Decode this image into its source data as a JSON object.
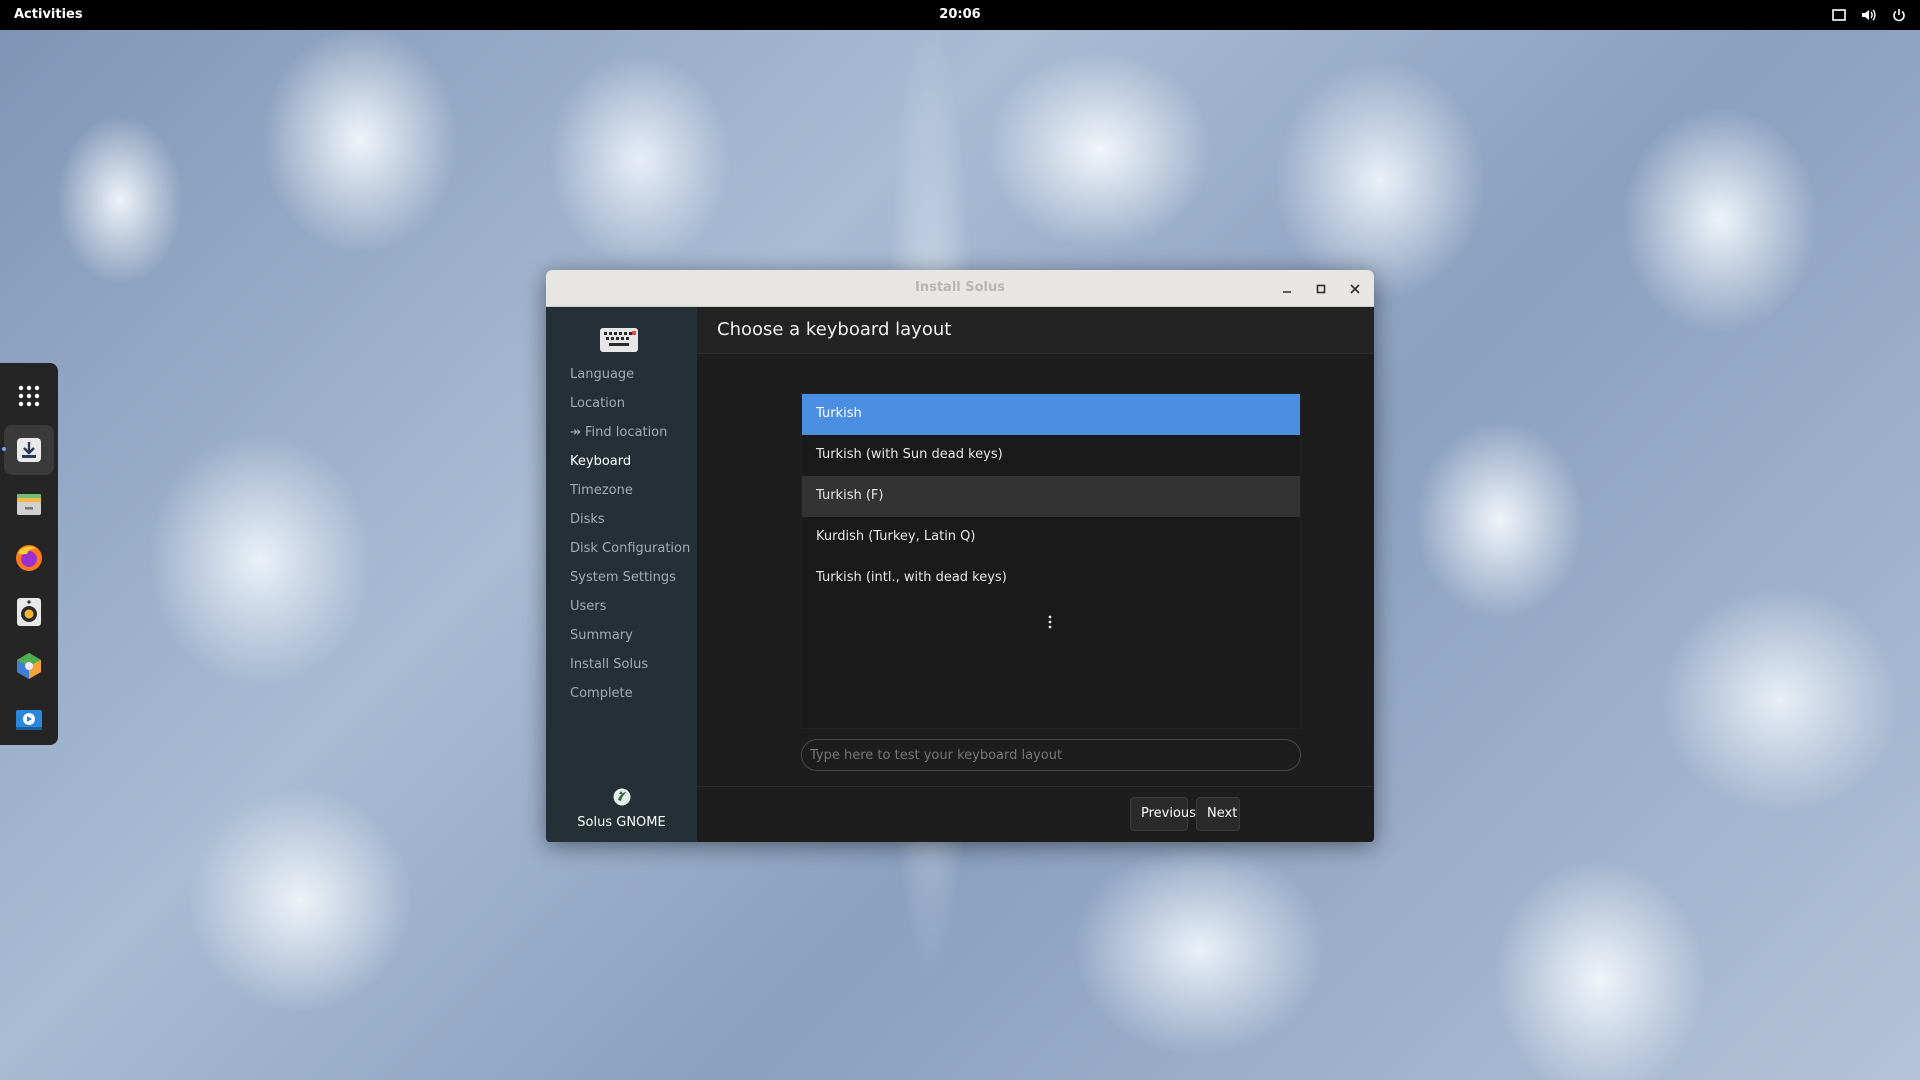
{
  "topbar": {
    "activities": "Activities",
    "clock": "20:06",
    "tray_icons": [
      "screen-icon",
      "volume-icon",
      "power-icon"
    ]
  },
  "dock": {
    "items": [
      "app-grid-icon",
      "installer-icon",
      "files-icon",
      "firefox-icon",
      "rhythmbox-icon",
      "software-icon",
      "video-icon"
    ]
  },
  "window": {
    "title": "Install Solus",
    "sidebar": {
      "items": [
        {
          "label": "Language",
          "active": false
        },
        {
          "label": "Location",
          "active": false
        },
        {
          "label": "↠ Find location",
          "active": false
        },
        {
          "label": "Keyboard",
          "active": true
        },
        {
          "label": "Timezone",
          "active": false
        },
        {
          "label": "Disks",
          "active": false
        },
        {
          "label": "Disk Configuration",
          "active": false
        },
        {
          "label": "System Settings",
          "active": false
        },
        {
          "label": "Users",
          "active": false
        },
        {
          "label": "Summary",
          "active": false
        },
        {
          "label": "Install Solus",
          "active": false
        },
        {
          "label": "Complete",
          "active": false
        }
      ],
      "brand": "Solus GNOME"
    },
    "header": {
      "title": "Choose a keyboard layout"
    },
    "layouts": [
      {
        "label": "Turkish",
        "state": "selected"
      },
      {
        "label": "Turkish (with Sun dead keys)",
        "state": "normal"
      },
      {
        "label": "Turkish (F)",
        "state": "hover"
      },
      {
        "label": "Kurdish (Turkey, Latin Q)",
        "state": "normal"
      },
      {
        "label": "Turkish (intl., with dead keys)",
        "state": "normal"
      }
    ],
    "test_input": {
      "placeholder": "Type here to test your keyboard layout",
      "value": ""
    },
    "buttons": {
      "previous": "Previous",
      "next": "Next"
    }
  },
  "colors": {
    "accent": "#4a8fe2",
    "sidebar_bg": "#243036"
  }
}
